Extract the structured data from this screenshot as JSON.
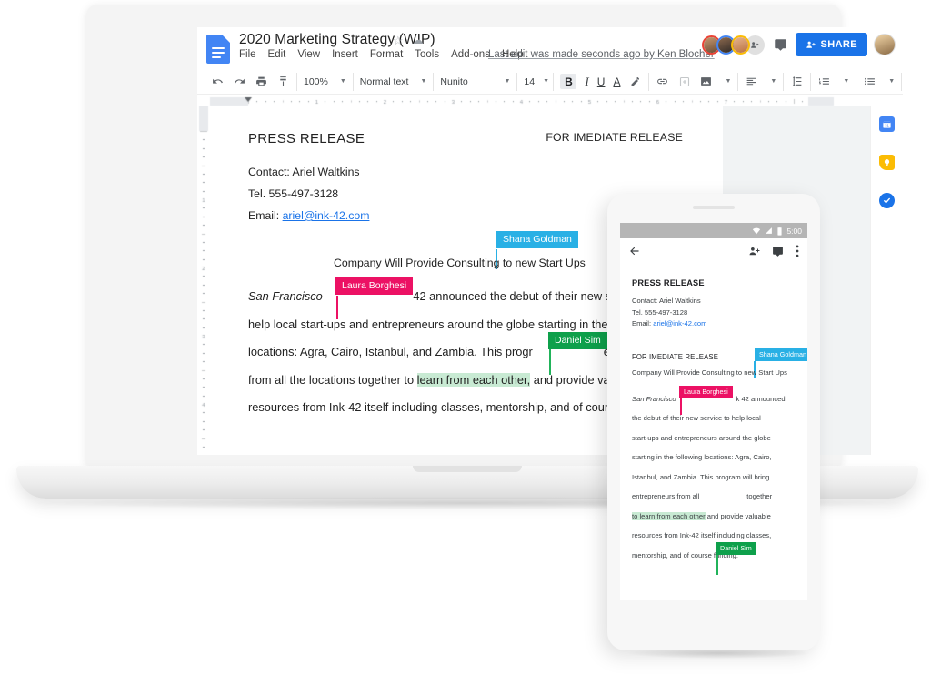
{
  "doc": {
    "title": "2020 Marketing Strategy (WIP)",
    "icons": {
      "star": "star-icon",
      "cloud": "cloud-icon",
      "app": "google-docs-icon"
    },
    "menu": [
      "File",
      "Edit",
      "View",
      "Insert",
      "Format",
      "Tools",
      "Add-ons",
      "Help"
    ],
    "last_edit": "Last edit was made seconds ago by Ken Blocher",
    "share_label": "SHARE",
    "collaborators": [
      {
        "name": "collaborator-1",
        "ring": "#ea4335"
      },
      {
        "name": "collaborator-2",
        "ring": "#4285f4"
      },
      {
        "name": "collaborator-3",
        "ring": "#fbbc04"
      }
    ]
  },
  "toolbar": {
    "undo": "undo-icon",
    "redo": "redo-icon",
    "print": "print-icon",
    "paint_format": "paint-format-icon",
    "zoom": "100%",
    "style": "Normal text",
    "font": "Nunito",
    "size": "14",
    "bold": "B",
    "italic": "I",
    "underline": "U",
    "text_color": "A",
    "highlight": "highlight-pen-icon",
    "link": "insert-link-icon",
    "comment": "add-comment-icon",
    "image": "insert-image-icon",
    "align": "align-left-icon",
    "line_spacing": "line-spacing-icon",
    "numbered_list": "numbered-list-icon",
    "bulleted_list": "bulleted-list-icon",
    "more": "more-options-icon",
    "edit_mode": "edit-pencil-icon",
    "collapse": "collapse-toolbar-icon"
  },
  "rail": [
    {
      "name": "google-calendar-icon",
      "color": "#4285f4",
      "glyph": "31"
    },
    {
      "name": "google-keep-icon",
      "color": "#fbbc04",
      "glyph": ""
    },
    {
      "name": "google-tasks-icon",
      "color": "#1a73e8",
      "glyph": "✓"
    }
  ],
  "document": {
    "heading": "PRESS RELEASE",
    "release_note": "FOR IMEDIATE RELEASE",
    "contact": "Contact: Ariel Waltkins",
    "tel": "Tel. 555-497-3128",
    "email_label": "Email: ",
    "email": "ariel@ink-42.com",
    "subheading_before": "Company Will Provide Consulting",
    "subheading_after": " to new Start Ups",
    "body": {
      "italic_lead": "San Francisco",
      "after_lead": " 42 announced the debut of their new service to help local start-ups and entrepreneurs around the globe starting in the following locations: Agra, Cairo, Istanbul, and Zambia. This progr",
      "after_daniel": " entrepreneurs from all the locations together to ",
      "highlighted": "learn from each other,",
      "tail": " and provide valuable resources from Ink-42 itself including classes, mentorship, and of course funding.",
      "line1_a": "San Francisco",
      "line1_b": "42 announced the debut of their new service to",
      "line2": "help local start-ups and entrepreneurs around the globe starting in the following",
      "line3_a": "locations: Agra, Cairo, Istanbul, and Zambia. This progr",
      "line3_b": "entrepreneurs",
      "line4_a": "from all the locations together to ",
      "line4_b": "learn from each other,",
      "line4_c": " and provide valuable",
      "line5": "resources from Ink-42 itself including classes, mentorship, and of course funding."
    }
  },
  "cursors": [
    {
      "label": "Shana Goldman",
      "color": "#29b0e5"
    },
    {
      "label": "Laura Borghesi",
      "color": "#ec1164"
    },
    {
      "label": "Daniel Sim",
      "color": "#0ea04b"
    }
  ],
  "phone": {
    "status": {
      "time": "5:00",
      "wifi": "wifi-icon",
      "signal": "signal-icon",
      "battery": "battery-icon"
    },
    "appbar": {
      "back": "back-arrow-icon",
      "add_person": "add-person-icon",
      "comment": "comment-icon",
      "overflow": "overflow-menu-icon"
    },
    "heading": "PRESS RELEASE",
    "contact": "Contact: Ariel Waltkins",
    "tel": "Tel. 555-497-3128",
    "email_label": "Email: ",
    "email": "ariel@ink-42.com",
    "release_note": "FOR IMEDIATE RELEASE",
    "subheading_before": "Company Will Provide Consulting",
    "subheading_after": " to new Start Ups",
    "lines": {
      "l1_italic": "San Francisco",
      "l1_rest": "k 42 announced",
      "l2": "the debut of their new service to help local",
      "l3": "start-ups and entrepreneurs around the globe",
      "l4": "starting in the following locations: Agra, Cairo,",
      "l5": "Istanbul, and Zambia. This program will bring",
      "l6_a": "entrepreneurs from all",
      "l6_b": "together",
      "l7_a": "to learn from each other",
      "l7_b": " and provide valuable",
      "l8": "resources from Ink-42 itself including classes,",
      "l9": "mentorship, and of course funding."
    }
  }
}
